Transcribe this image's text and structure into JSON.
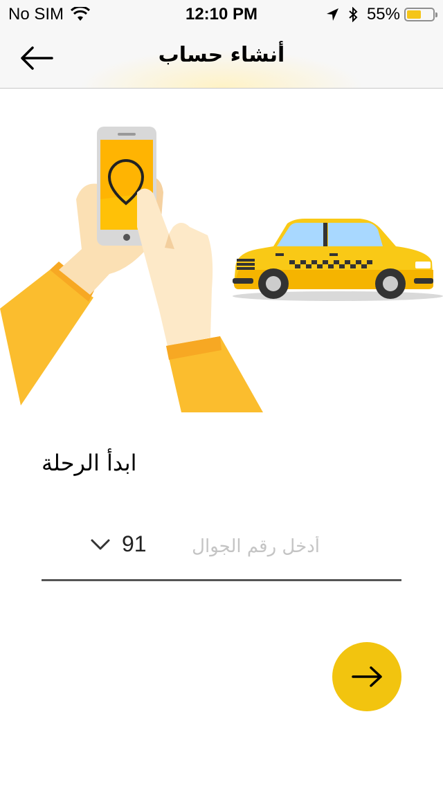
{
  "status_bar": {
    "carrier": "No SIM",
    "time": "12:10 PM",
    "battery_percent_text": "55%",
    "battery_level": 0.55,
    "icons": [
      "wifi-icon",
      "location-arrow-icon",
      "bluetooth-icon",
      "battery-icon"
    ]
  },
  "nav": {
    "title": "أنشاء حساب",
    "back_icon": "arrow-left-icon"
  },
  "illustration": {
    "description_icons": [
      "hand-holding-phone",
      "map-pin-icon",
      "taxi-car"
    ]
  },
  "form": {
    "heading": "ابدأ الرحلة",
    "country_code": "91",
    "phone_placeholder": "أدخل رقم الجوال",
    "phone_value": ""
  },
  "next_button": {
    "icon": "arrow-right-icon"
  },
  "colors": {
    "accent_yellow": "#f2c40f",
    "sleeve_yellow": "#fbbd2e",
    "skin": "#fde3b8",
    "underline": "#555555"
  }
}
